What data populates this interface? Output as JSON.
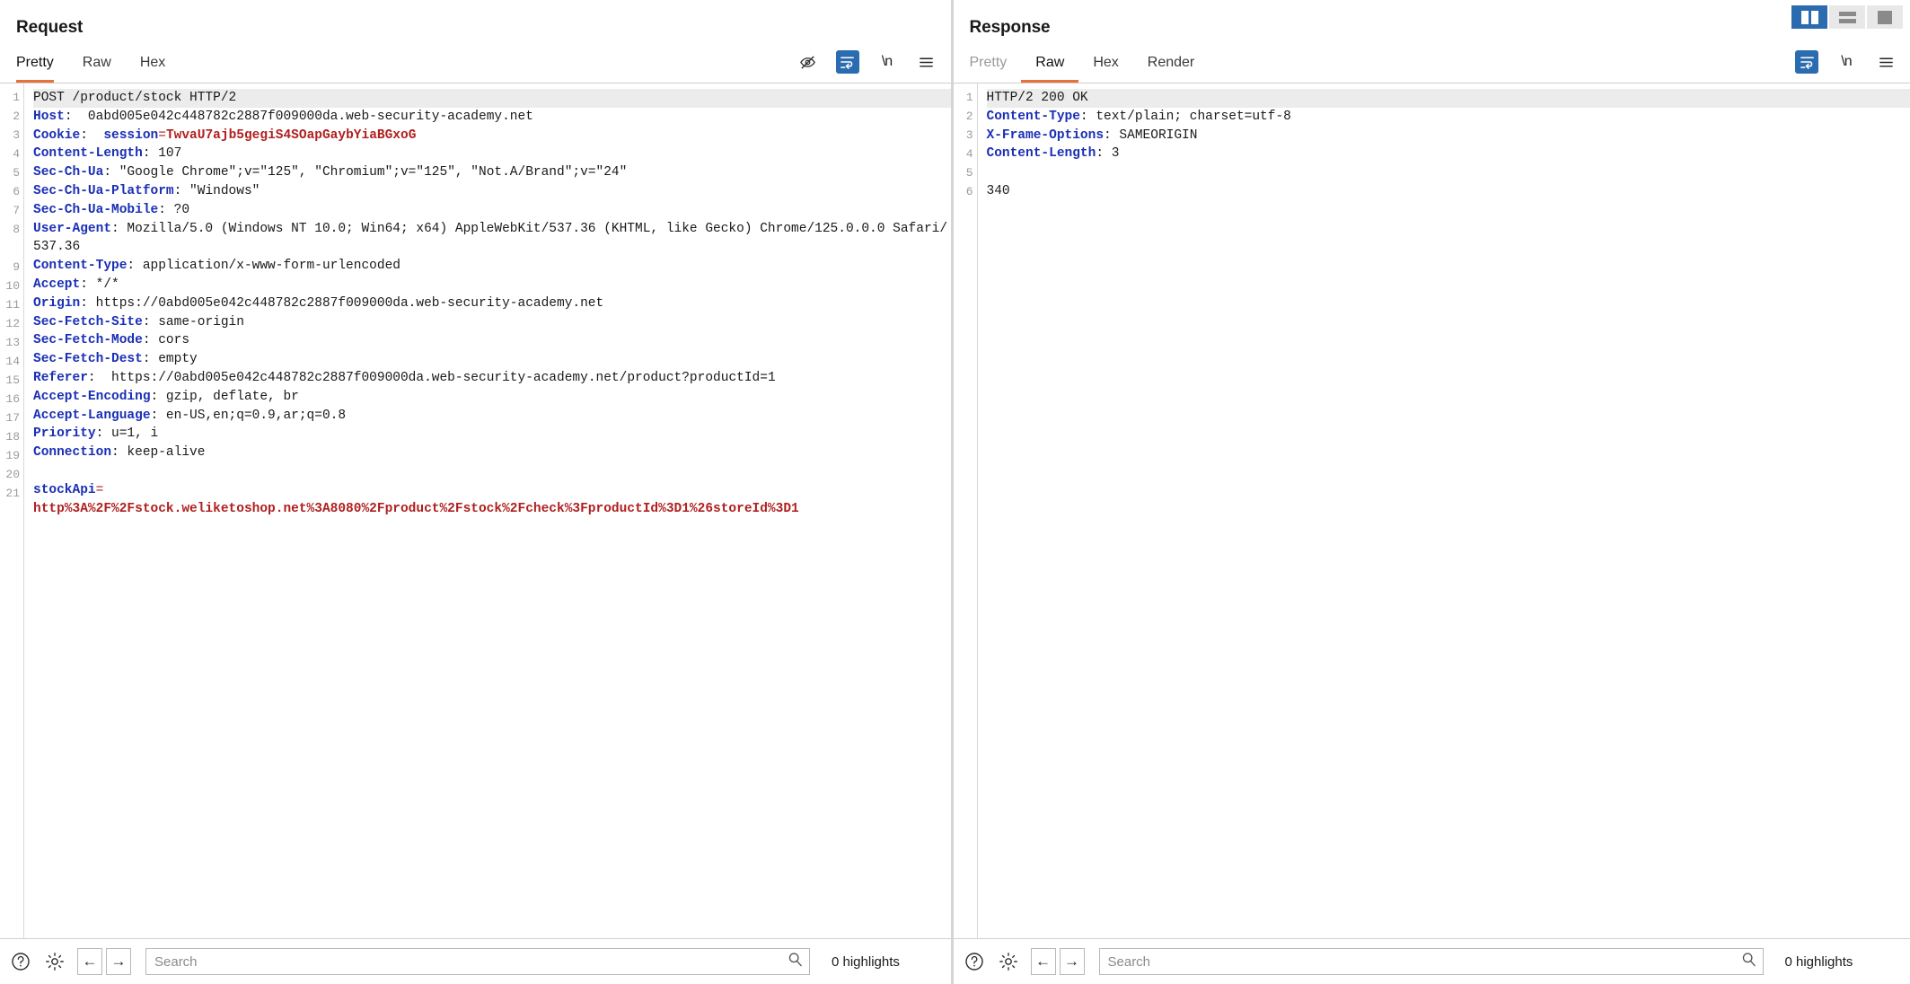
{
  "window": {
    "layout_toggles": [
      {
        "name": "split-view",
        "label": "Side by side",
        "active": true
      },
      {
        "name": "stacked-view",
        "label": "Stacked",
        "active": false
      },
      {
        "name": "single-view",
        "label": "Single",
        "active": false
      }
    ]
  },
  "request": {
    "title": "Request",
    "tabs": [
      {
        "label": "Pretty",
        "active": true
      },
      {
        "label": "Raw",
        "active": false
      },
      {
        "label": "Hex",
        "active": false
      }
    ],
    "icons": [
      {
        "name": "eye-slash-icon",
        "label": "Show non-printable characters",
        "active": false
      },
      {
        "name": "word-wrap-icon",
        "label": "Word wrap",
        "active": true
      },
      {
        "name": "newline-icon",
        "label": "\\n",
        "active": false
      },
      {
        "name": "menu-icon",
        "label": "Menu",
        "active": false
      }
    ],
    "lines": [
      {
        "n": "1",
        "first": true,
        "parts": [
          {
            "t": "POST /product/stock HTTP/2",
            "c": "hplain"
          }
        ]
      },
      {
        "n": "2",
        "parts": [
          {
            "t": "Host",
            "c": "hk"
          },
          {
            "t": ":  0abd005e042c448782c2887f009000da.web-security-academy.net",
            "c": "hv"
          }
        ]
      },
      {
        "n": "3",
        "parts": [
          {
            "t": "Cookie",
            "c": "hk"
          },
          {
            "t": ":  ",
            "c": "hv"
          },
          {
            "t": "session",
            "c": "hblue-b"
          },
          {
            "t": "=",
            "c": "hred"
          },
          {
            "t": "TwvaU7ajb5gegiS4SOapGaybYiaBGxoG",
            "c": "hred-b"
          }
        ]
      },
      {
        "n": "4",
        "parts": [
          {
            "t": "Content-Length",
            "c": "hk"
          },
          {
            "t": ": 107",
            "c": "hv"
          }
        ]
      },
      {
        "n": "5",
        "parts": [
          {
            "t": "Sec-Ch-Ua",
            "c": "hk"
          },
          {
            "t": ": \"Google Chrome\";v=\"125\", \"Chromium\";v=\"125\", \"Not.A/Brand\";v=\"24\"",
            "c": "hv"
          }
        ]
      },
      {
        "n": "6",
        "parts": [
          {
            "t": "Sec-Ch-Ua-Platform",
            "c": "hk"
          },
          {
            "t": ": \"Windows\"",
            "c": "hv"
          }
        ]
      },
      {
        "n": "7",
        "parts": [
          {
            "t": "Sec-Ch-Ua-Mobile",
            "c": "hk"
          },
          {
            "t": ": ?0",
            "c": "hv"
          }
        ]
      },
      {
        "n": "8",
        "parts": [
          {
            "t": "User-Agent",
            "c": "hk"
          },
          {
            "t": ": Mozilla/5.0 (Windows NT 10.0; Win64; x64) AppleWebKit/537.36 (KHTML, like Gecko) Chrome/125.0.0.0 Safari/537.36",
            "c": "hv"
          }
        ]
      },
      {
        "n": "9",
        "parts": [
          {
            "t": "Content-Type",
            "c": "hk"
          },
          {
            "t": ": application/x-www-form-urlencoded",
            "c": "hv"
          }
        ]
      },
      {
        "n": "10",
        "parts": [
          {
            "t": "Accept",
            "c": "hk"
          },
          {
            "t": ": */*",
            "c": "hv"
          }
        ]
      },
      {
        "n": "11",
        "parts": [
          {
            "t": "Origin",
            "c": "hk"
          },
          {
            "t": ": https://0abd005e042c448782c2887f009000da.web-security-academy.net",
            "c": "hv"
          }
        ]
      },
      {
        "n": "12",
        "parts": [
          {
            "t": "Sec-Fetch-Site",
            "c": "hk"
          },
          {
            "t": ": same-origin",
            "c": "hv"
          }
        ]
      },
      {
        "n": "13",
        "parts": [
          {
            "t": "Sec-Fetch-Mode",
            "c": "hk"
          },
          {
            "t": ": cors",
            "c": "hv"
          }
        ]
      },
      {
        "n": "14",
        "parts": [
          {
            "t": "Sec-Fetch-Dest",
            "c": "hk"
          },
          {
            "t": ": empty",
            "c": "hv"
          }
        ]
      },
      {
        "n": "15",
        "parts": [
          {
            "t": "Referer",
            "c": "hk"
          },
          {
            "t": ":  https://0abd005e042c448782c2887f009000da.web-security-academy.net/product?productId=1",
            "c": "hv"
          }
        ]
      },
      {
        "n": "16",
        "parts": [
          {
            "t": "Accept-Encoding",
            "c": "hk"
          },
          {
            "t": ": gzip, deflate, br",
            "c": "hv"
          }
        ]
      },
      {
        "n": "17",
        "parts": [
          {
            "t": "Accept-Language",
            "c": "hk"
          },
          {
            "t": ": en-US,en;q=0.9,ar;q=0.8",
            "c": "hv"
          }
        ]
      },
      {
        "n": "18",
        "parts": [
          {
            "t": "Priority",
            "c": "hk"
          },
          {
            "t": ": u=1, i",
            "c": "hv"
          }
        ]
      },
      {
        "n": "19",
        "parts": [
          {
            "t": "Connection",
            "c": "hk"
          },
          {
            "t": ": keep-alive",
            "c": "hv"
          }
        ]
      },
      {
        "n": "20",
        "parts": []
      },
      {
        "n": "21",
        "parts": [
          {
            "t": "stockApi",
            "c": "hblue-b"
          },
          {
            "t": "=\n",
            "c": "hred"
          },
          {
            "t": "http%3A%2F%2Fstock.weliketoshop.net%3A8080%2Fproduct%2Fstock%2Fcheck%3FproductId%3D1%26storeId%3D1",
            "c": "hred-b"
          }
        ]
      }
    ],
    "search": {
      "value": "",
      "placeholder": "Search"
    },
    "highlights": "0 highlights"
  },
  "response": {
    "title": "Response",
    "tabs": [
      {
        "label": "Pretty",
        "active": false,
        "disabled": true
      },
      {
        "label": "Raw",
        "active": true
      },
      {
        "label": "Hex",
        "active": false
      },
      {
        "label": "Render",
        "active": false
      }
    ],
    "icons": [
      {
        "name": "word-wrap-icon",
        "label": "Word wrap",
        "active": true
      },
      {
        "name": "newline-icon",
        "label": "\\n",
        "active": false
      },
      {
        "name": "menu-icon",
        "label": "Menu",
        "active": false
      }
    ],
    "lines": [
      {
        "n": "1",
        "first": true,
        "parts": [
          {
            "t": "HTTP/2 200 OK",
            "c": "hplain"
          }
        ]
      },
      {
        "n": "2",
        "parts": [
          {
            "t": "Content-Type",
            "c": "hk"
          },
          {
            "t": ": text/plain; charset=utf-8",
            "c": "hv"
          }
        ]
      },
      {
        "n": "3",
        "parts": [
          {
            "t": "X-Frame-Options",
            "c": "hk"
          },
          {
            "t": ": SAMEORIGIN",
            "c": "hv"
          }
        ]
      },
      {
        "n": "4",
        "parts": [
          {
            "t": "Content-Length",
            "c": "hk"
          },
          {
            "t": ": 3",
            "c": "hv"
          }
        ]
      },
      {
        "n": "5",
        "parts": []
      },
      {
        "n": "6",
        "parts": [
          {
            "t": "340",
            "c": "hplain"
          }
        ]
      }
    ],
    "search": {
      "value": "",
      "placeholder": "Search"
    },
    "highlights": "0 highlights"
  },
  "bottom_icons": [
    {
      "name": "help-icon",
      "label": "?"
    },
    {
      "name": "gear-icon",
      "label": "Settings"
    },
    {
      "name": "back-arrow-icon",
      "label": "←"
    },
    {
      "name": "forward-arrow-icon",
      "label": "→"
    }
  ],
  "colors": {
    "accent_blue": "#2b6cb0",
    "tab_underline": "#e8703a",
    "header_key": "#1a2fb5",
    "value_red": "#b01f1f"
  }
}
